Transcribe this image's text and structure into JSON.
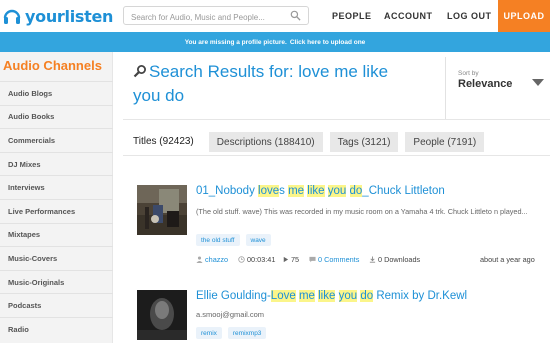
{
  "header": {
    "logo_text": "yourlisten",
    "search_placeholder": "Search for Audio, Music and People...",
    "nav": {
      "people": "PEOPLE",
      "account": "ACCOUNT",
      "logout": "LOG OUT",
      "upload": "UPLOAD"
    }
  },
  "notice": {
    "text": "You are missing a profile picture.",
    "link": "Click here to upload one"
  },
  "sidebar": {
    "title": "Audio Channels",
    "items": [
      {
        "label": "Audio Blogs"
      },
      {
        "label": "Audio Books"
      },
      {
        "label": "Commercials"
      },
      {
        "label": "DJ Mixes"
      },
      {
        "label": "Interviews"
      },
      {
        "label": "Live Performances"
      },
      {
        "label": "Mixtapes"
      },
      {
        "label": "Music-Covers"
      },
      {
        "label": "Music-Originals"
      },
      {
        "label": "Podcasts"
      },
      {
        "label": "Radio"
      }
    ]
  },
  "search": {
    "title_line1": "Search Results for: love me like",
    "title_line2": "you do"
  },
  "sort": {
    "label": "Sort by",
    "value": "Relevance"
  },
  "tabs": [
    {
      "label": "Titles (92423)",
      "active": true
    },
    {
      "label": "Descriptions (188410)",
      "active": false
    },
    {
      "label": "Tags (3121)",
      "active": false
    },
    {
      "label": "People (7191)",
      "active": false
    }
  ],
  "results": [
    {
      "title_parts": {
        "a": "01_Nobody ",
        "b": "love",
        "c": "s ",
        "d": "me",
        "e": " ",
        "f": "like",
        "g": " ",
        "h": "you",
        "i": " ",
        "j": "do",
        "k": "_Chuck Littleton"
      },
      "description": "(The old stuff. wave) This was recorded in my music room on a Yamaha 4 trk. Chuck Littleto n played...",
      "tags": [
        "the old stuff",
        "wave"
      ],
      "meta": {
        "user": "chazzo",
        "duration": "00:03:41",
        "plays": "75",
        "comments": "0 Comments",
        "downloads": "0 Downloads",
        "age": "about a year ago"
      }
    },
    {
      "title_parts": {
        "a": "Ellie Goulding-",
        "b": "Love",
        "c": " ",
        "d": "me",
        "e": " ",
        "f": "like",
        "g": " ",
        "h": "you",
        "i": " ",
        "j": "do",
        "k": " Remix by Dr.Kewl"
      },
      "email": "a.smooj@gmail.com",
      "tags": [
        "remix",
        "remixmp3"
      ]
    }
  ],
  "colors": {
    "brand_blue": "#1e90d6",
    "upload_orange": "#f58023",
    "notice_bg": "#33a5de",
    "highlight": "#fbf58a"
  },
  "icons": [
    "headphones-logo-icon",
    "search-icon",
    "magnifier-icon",
    "user-icon",
    "clock-icon",
    "play-icon",
    "comment-icon",
    "download-icon",
    "chevron-down-icon"
  ]
}
